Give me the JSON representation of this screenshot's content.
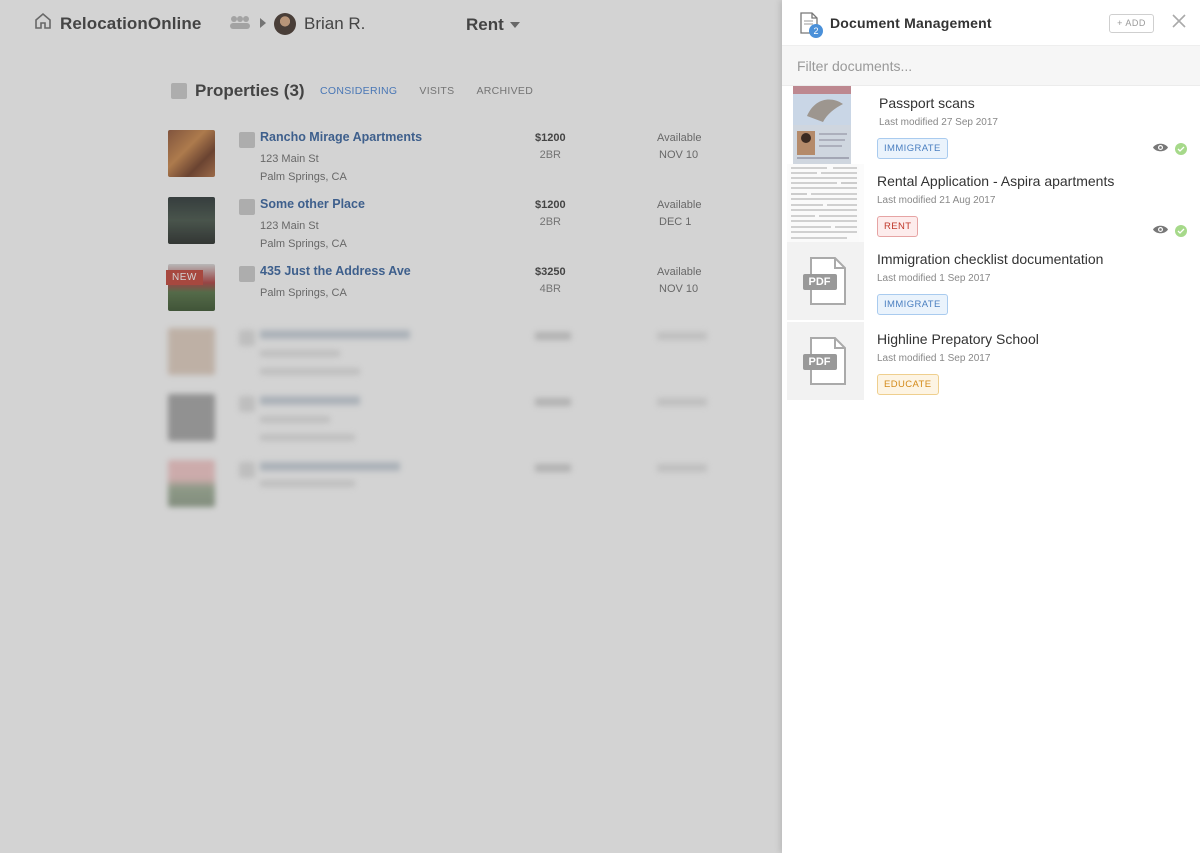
{
  "app": {
    "logo_text": "RelocationOnline",
    "user_name": "Brian R.",
    "mode_label": "Rent"
  },
  "properties": {
    "title": "Properties (3)",
    "tabs": [
      {
        "label": "CONSIDERING",
        "active": true
      },
      {
        "label": "VISITS",
        "active": false
      },
      {
        "label": "ARCHIVED",
        "active": false
      }
    ],
    "items": [
      {
        "name": "Rancho Mirage Apartments",
        "addr1": "123 Main St",
        "addr2": "Palm Springs, CA",
        "price": "$1200",
        "beds": "2BR",
        "avail_label": "Available",
        "avail_date": "NOV 10"
      },
      {
        "name": "Some other Place",
        "addr1": "123 Main St",
        "addr2": "Palm Springs, CA",
        "price": "$1200",
        "beds": "2BR",
        "avail_label": "Available",
        "avail_date": "DEC 1"
      },
      {
        "name": "435 Just the Address Ave",
        "addr1": "Palm Springs, CA",
        "addr2": "",
        "price": "$3250",
        "beds": "4BR",
        "avail_label": "Available",
        "avail_date": "NOV 10",
        "badge": "NEW"
      }
    ]
  },
  "panel": {
    "title": "Document Management",
    "doc_count": "2",
    "add_label": "+ ADD",
    "filter_placeholder": "Filter documents...",
    "pdf_label": "PDF",
    "documents": [
      {
        "name": "Passport scans",
        "modified": "Last modified 27 Sep 2017",
        "tag": "IMMIGRATE",
        "tag_color": "#4a7fc0"
      },
      {
        "name": "Rental Application - Aspira apartments",
        "modified": "Last modified 21 Aug 2017",
        "tag": "RENT",
        "tag_color": "#c0392b"
      },
      {
        "name": "Immigration checklist documentation",
        "modified": "Last modified 1 Sep 2017",
        "tag": "IMMIGRATE",
        "tag_color": "#4a7fc0"
      },
      {
        "name": "Highline Prepatory School",
        "modified": "Last modified 1 Sep 2017",
        "tag": "EDUCATE",
        "tag_color": "#d38a1a"
      }
    ]
  }
}
